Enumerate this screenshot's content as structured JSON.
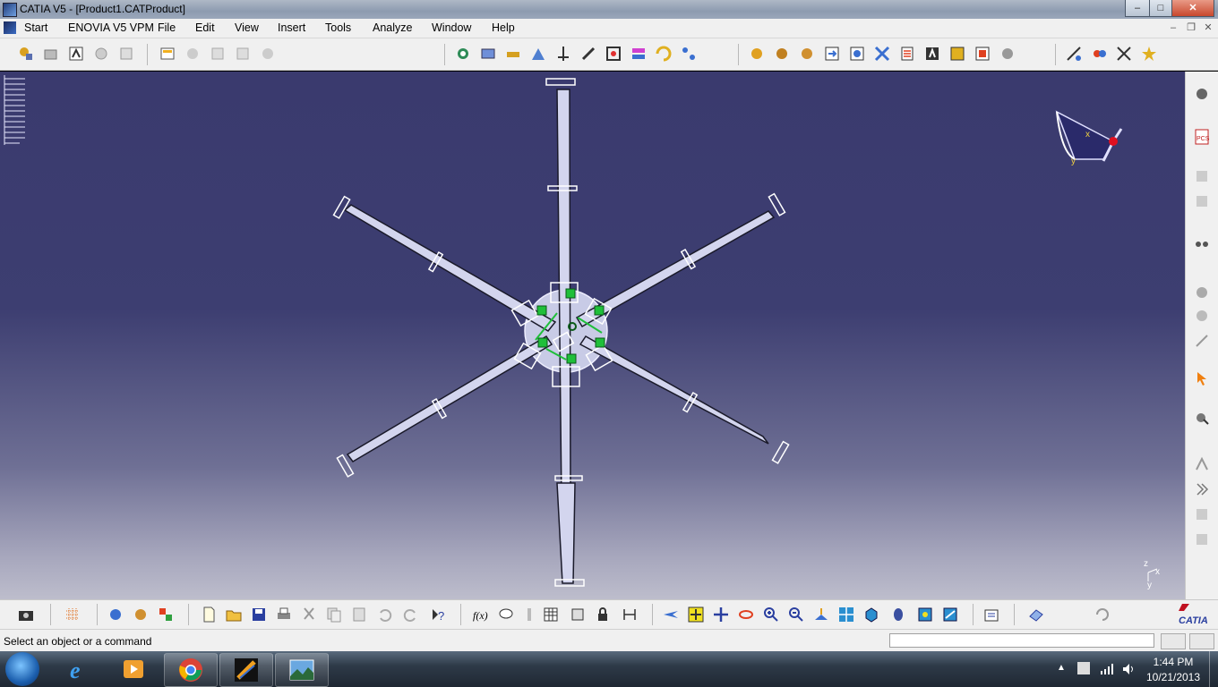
{
  "window": {
    "title": "CATIA V5 - [Product1.CATProduct]",
    "controls": {
      "minimize": "–",
      "maximize": "□",
      "close": "✕"
    },
    "doc_controls": {
      "minimize": "–",
      "restore": "❐",
      "close": "✕"
    }
  },
  "menu": {
    "items": [
      "Start",
      "ENOVIA V5 VPM",
      "File",
      "Edit",
      "View",
      "Insert",
      "Tools",
      "Analyze",
      "Window",
      "Help"
    ]
  },
  "status": {
    "message": "Select an object or a command",
    "input_value": ""
  },
  "viewport": {
    "compass_labels": {
      "x": "x",
      "y": "y"
    },
    "axis_labels": {
      "x": "x",
      "y": "y",
      "z": "z"
    }
  },
  "branding": {
    "logo_text": "CATIA"
  },
  "taskbar": {
    "time": "1:44 PM",
    "date": "10/21/2013"
  },
  "colors": {
    "viewport_top": "#3a3a6e",
    "viewport_bottom": "#bdbdcc",
    "constraint_green": "#1fbf3a",
    "blade_fill": "#c8cbe6",
    "compass_red": "#e01020"
  }
}
